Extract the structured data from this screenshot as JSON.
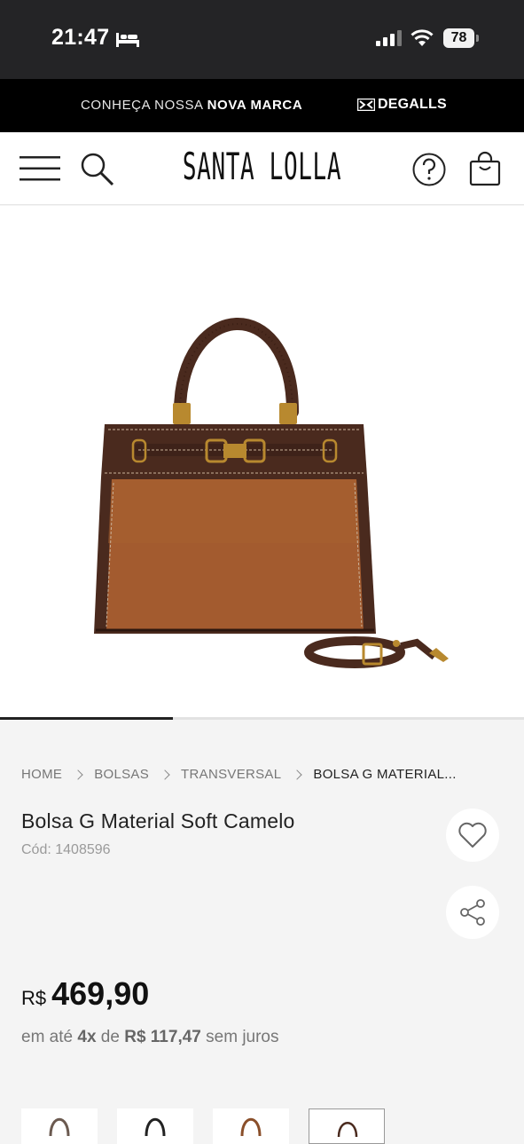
{
  "status_bar": {
    "time": "21:47",
    "battery": "78"
  },
  "promo": {
    "prefix": "CONHEÇA NOSSA",
    "highlight": "NOVA MARCA",
    "brand": "DEGALLS"
  },
  "header": {
    "logo": "SANTA LOLLA"
  },
  "gallery": {
    "progress": 0.33
  },
  "breadcrumb": [
    {
      "label": "HOME"
    },
    {
      "label": "BOLSAS"
    },
    {
      "label": "TRANSVERSAL"
    },
    {
      "label": "BOLSA G MATERIAL..."
    }
  ],
  "product": {
    "title": "Bolsa G Material Soft Camelo",
    "code": "Cód: 1408596",
    "currency": "R$",
    "price": "469,90",
    "installments": {
      "prefix": "em até",
      "count": "4x",
      "of": "de",
      "value": "R$ 117,47",
      "suffix": "sem juros"
    }
  },
  "colors": {
    "accent": "#000000",
    "bag_body": "#a05a30",
    "bag_trim": "#4a2a1e"
  }
}
